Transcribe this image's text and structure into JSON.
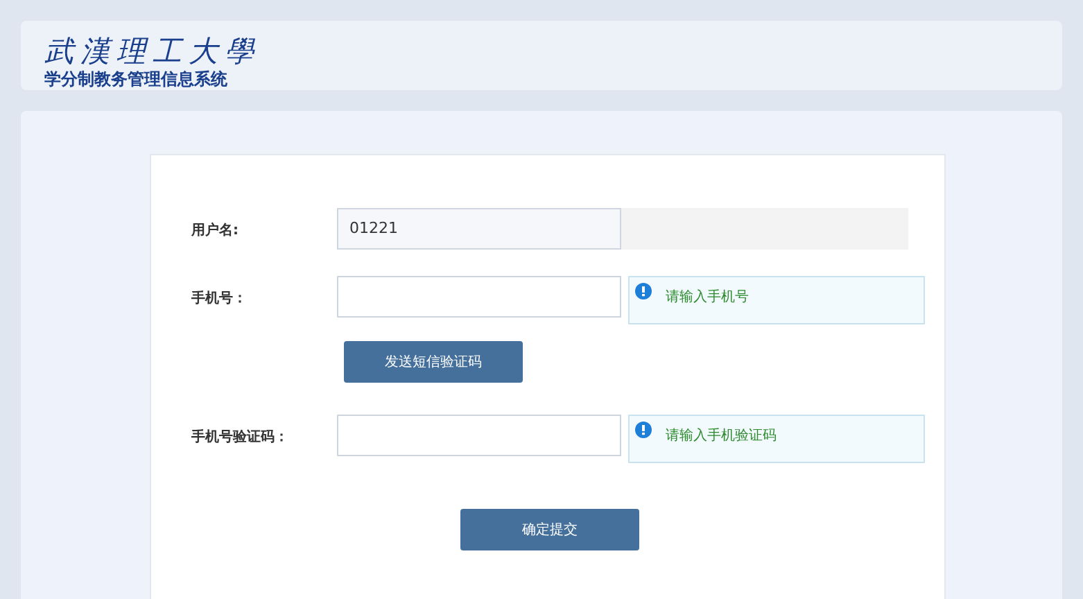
{
  "header": {
    "logo": "武漢理工大學",
    "subtitle": "学分制教务管理信息系统"
  },
  "form": {
    "rows": [
      {
        "kind": "readonly",
        "label": "用户名:",
        "value": "01221"
      },
      {
        "kind": "input",
        "label": "手机号：",
        "hint": "请输入手机号"
      },
      {
        "kind": "button",
        "label": "发送短信验证码"
      },
      {
        "kind": "input",
        "label": "手机号验证码：",
        "hint": "请输入手机验证码"
      }
    ],
    "submit": "确定提交"
  }
}
